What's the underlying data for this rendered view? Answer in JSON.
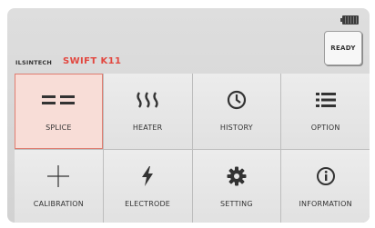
{
  "header": {
    "brand": "ILSINTECH",
    "model": "SWIFT K11",
    "ready_label": "READY",
    "battery_icon": "battery-icon"
  },
  "menu": {
    "items": [
      {
        "label": "SPLICE",
        "icon": "splice-icon",
        "selected": true
      },
      {
        "label": "HEATER",
        "icon": "heater-icon",
        "selected": false
      },
      {
        "label": "HISTORY",
        "icon": "clock-icon",
        "selected": false
      },
      {
        "label": "OPTION",
        "icon": "list-icon",
        "selected": false
      },
      {
        "label": "CALIBRATION",
        "icon": "crosshair-icon",
        "selected": false
      },
      {
        "label": "ELECTRODE",
        "icon": "lightning-icon",
        "selected": false
      },
      {
        "label": "SETTING",
        "icon": "gear-icon",
        "selected": false
      },
      {
        "label": "INFORMATION",
        "icon": "info-icon",
        "selected": false
      }
    ]
  },
  "colors": {
    "model_text": "#e2473f",
    "selected_tile_bg": "#f8ddd7",
    "selected_tile_border": "#e07d70"
  }
}
